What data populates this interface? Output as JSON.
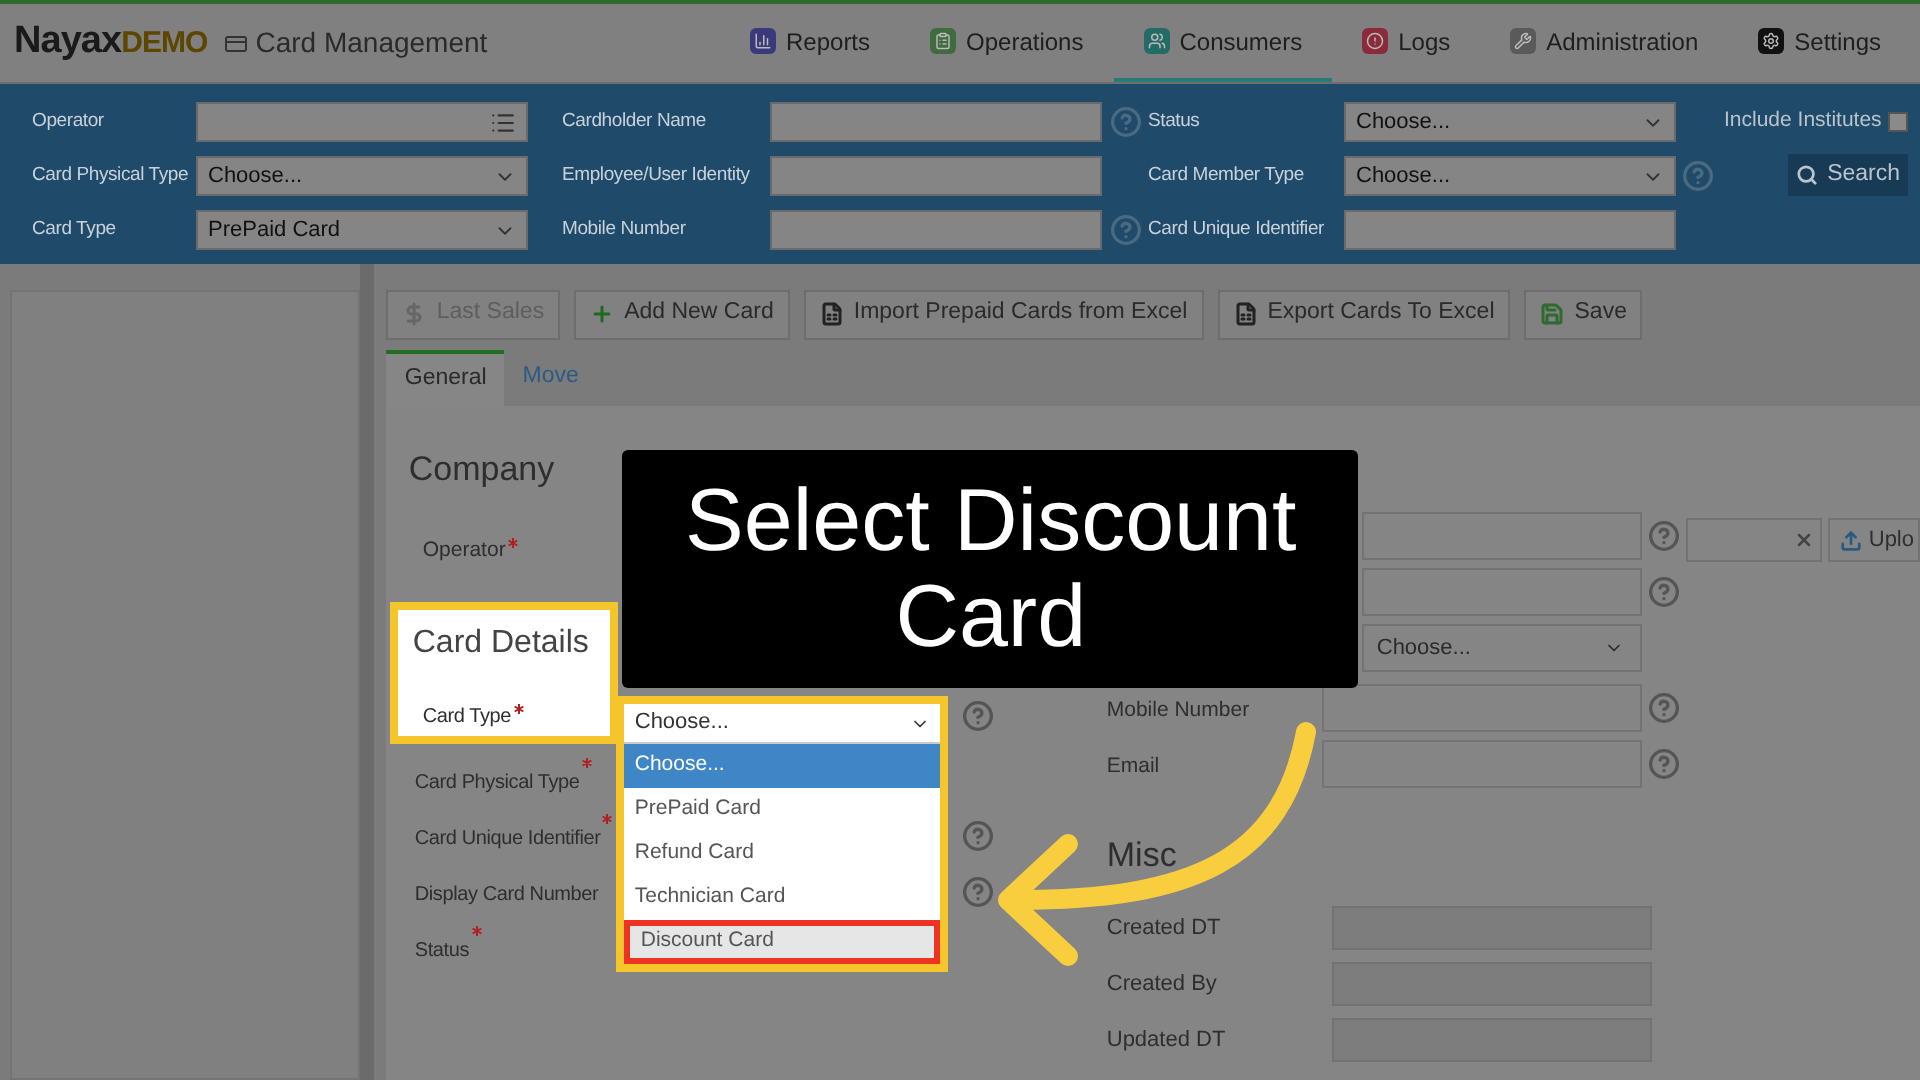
{
  "header": {
    "logo": "Nayax",
    "logo_suffix": "DEMO",
    "page_title": "Card Management",
    "nav": [
      {
        "label": "Reports",
        "kind": "chart",
        "selected": false
      },
      {
        "label": "Operations",
        "kind": "clipboard",
        "selected": false
      },
      {
        "label": "Consumers",
        "kind": "users",
        "selected": true
      },
      {
        "label": "Logs",
        "kind": "alert",
        "selected": false
      },
      {
        "label": "Administration",
        "kind": "tools",
        "selected": false
      },
      {
        "label": "Settings",
        "kind": "gear",
        "selected": false
      }
    ]
  },
  "filters": {
    "columns": [
      [
        {
          "label": "Operator",
          "kind": "list",
          "help": false
        },
        {
          "label": "Card Physical Type",
          "kind": "select",
          "value": "Choose...",
          "help": false
        },
        {
          "label": "Card Type",
          "kind": "select",
          "value": "PrePaid Card",
          "help": false
        }
      ],
      [
        {
          "label": "Cardholder Name",
          "kind": "text",
          "help": true
        },
        {
          "label": "Employee/User Identity",
          "kind": "text",
          "help": false
        },
        {
          "label": "Mobile Number",
          "kind": "text",
          "help": true
        }
      ],
      [
        {
          "label": "Status",
          "kind": "select",
          "value": "Choose...",
          "help": false
        },
        {
          "label": "Card Member Type",
          "kind": "select",
          "value": "Choose...",
          "help": true
        },
        {
          "label": "Card Unique Identifier",
          "kind": "text",
          "help": false
        }
      ]
    ],
    "include_institutes": {
      "label": "Include Institutes",
      "checked": false
    },
    "search_button": "Search"
  },
  "toolbar": [
    {
      "label": "Last Sales",
      "kind": "dollar",
      "disabled": true
    },
    {
      "label": "Add New Card",
      "kind": "plus",
      "disabled": false
    },
    {
      "label": "Import Prepaid Cards from Excel",
      "kind": "excel",
      "disabled": false
    },
    {
      "label": "Export Cards To Excel",
      "kind": "excel",
      "disabled": false
    },
    {
      "label": "Save",
      "kind": "save",
      "disabled": false
    }
  ],
  "tabs": [
    {
      "label": "General",
      "selected": true
    },
    {
      "label": "Move",
      "selected": false
    }
  ],
  "company": {
    "heading": "Company",
    "fields": [
      {
        "label": "Operator",
        "required": true
      }
    ]
  },
  "card_details": {
    "heading": "Card Details",
    "highlighted": true,
    "fields": [
      {
        "label": "Card Type",
        "required": true,
        "help": true
      },
      {
        "label": "Card Physical Type",
        "required": true,
        "help": false
      },
      {
        "label": "Card Unique Identifier",
        "required": true,
        "help": true
      },
      {
        "label": "Display Card Number",
        "required": false,
        "help": true
      },
      {
        "label": "Status",
        "required": true,
        "help": false
      }
    ]
  },
  "card_type_dropdown": {
    "value": "Choose...",
    "options": [
      {
        "label": "Choose...",
        "selected": true,
        "highlighted": false
      },
      {
        "label": "PrePaid Card",
        "selected": false,
        "highlighted": false
      },
      {
        "label": "Refund Card",
        "selected": false,
        "highlighted": false
      },
      {
        "label": "Technician Card",
        "selected": false,
        "highlighted": false
      },
      {
        "label": "Discount Card",
        "selected": false,
        "highlighted": true
      }
    ]
  },
  "contact": {
    "fields": [
      {
        "kind": "text",
        "help": true
      },
      {
        "kind": "text",
        "help": true
      },
      {
        "kind": "select",
        "value": "Choose...",
        "help": false
      },
      {
        "label": "Mobile Number",
        "kind": "text",
        "help": true
      },
      {
        "label": "Email",
        "kind": "text",
        "help": true
      }
    ]
  },
  "upload": {
    "button": "Uplo"
  },
  "misc": {
    "heading": "Misc",
    "fields": [
      {
        "label": "Created DT"
      },
      {
        "label": "Created By"
      },
      {
        "label": "Updated DT"
      }
    ]
  },
  "callout": {
    "text": "Select Discount Card"
  }
}
